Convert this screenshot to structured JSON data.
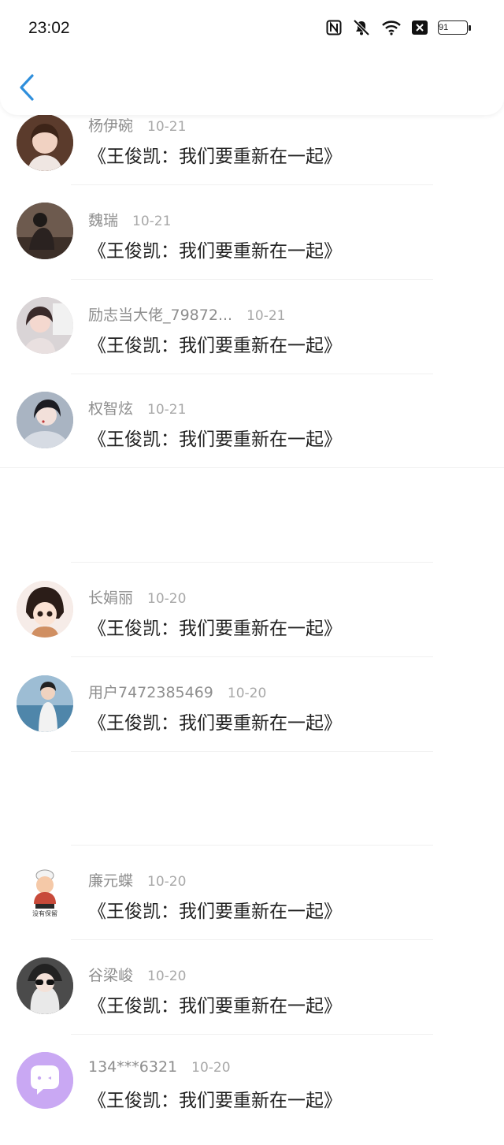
{
  "status_bar": {
    "time": "23:02",
    "battery": "91",
    "icons": [
      "nfc-icon",
      "mute-icon",
      "wifi-icon",
      "notification-icon",
      "battery-icon"
    ]
  },
  "nav": {
    "back_icon": "chevron-left-icon",
    "accent": "#2f8fdc"
  },
  "items": [
    {
      "name": "杨伊碗",
      "date": "10-21",
      "message": "《王俊凯：我们要重新在一起》",
      "avatar_color": "#6b4a3a"
    },
    {
      "name": "魏瑞",
      "date": "10-21",
      "message": "《王俊凯：我们要重新在一起》",
      "avatar_color": "#3a2e2a"
    },
    {
      "name": "励志当大佬_79872...",
      "date": "10-21",
      "message": "《王俊凯：我们要重新在一起》",
      "avatar_color": "#cfc6c8"
    },
    {
      "name": "权智炫",
      "date": "10-21",
      "message": "《王俊凯：我们要重新在一起》",
      "avatar_color": "#9aa6b6"
    },
    {
      "name": "长娟丽",
      "date": "10-20",
      "message": "《王俊凯：我们要重新在一起》",
      "avatar_color": "#f2d7cf"
    },
    {
      "name": "用户7472385469",
      "date": "10-20",
      "message": "《王俊凯：我们要重新在一起》",
      "avatar_color": "#7fa8c4"
    },
    {
      "name": "廉元蝶",
      "date": "10-20",
      "message": "《王俊凯：我们要重新在一起》",
      "avatar_color": "#f4e3d7",
      "avatar_caption": "没有保留"
    },
    {
      "name": "谷梁峻",
      "date": "10-20",
      "message": "《王俊凯：我们要重新在一起》",
      "avatar_color": "#5a5a5a"
    },
    {
      "name": "134***6321",
      "date": "10-20",
      "message": "《王俊凯：我们要重新在一起》",
      "avatar_color": "#c9a8f3"
    }
  ]
}
